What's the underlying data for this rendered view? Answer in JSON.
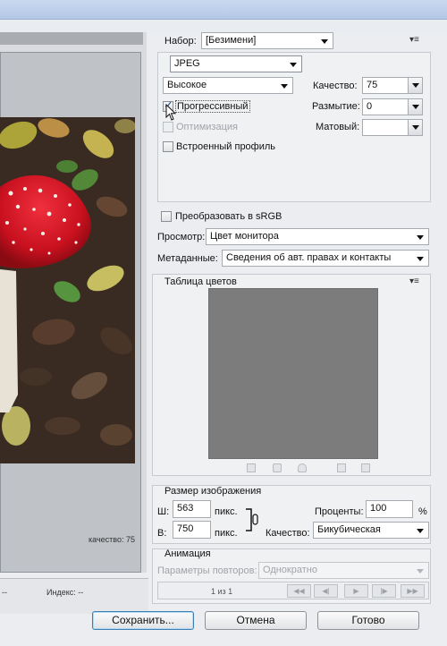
{
  "preset": {
    "label": "Набор:",
    "value": "[Безимени]"
  },
  "format": {
    "value": "JPEG"
  },
  "quality_preset": {
    "value": "Высокое"
  },
  "quality": {
    "label": "Качество:",
    "value": "75"
  },
  "blur": {
    "label": "Размытие:",
    "value": "0"
  },
  "matte": {
    "label": "Матовый:",
    "value": ""
  },
  "checks": {
    "progressive": {
      "label": "Прогрессивный",
      "checked": true
    },
    "optimized": {
      "label": "Оптимизация",
      "checked": false,
      "disabled": true
    },
    "embed_profile": {
      "label": "Встроенный профиль",
      "checked": false
    }
  },
  "convert_srgb": {
    "label": "Преобразовать в sRGB",
    "checked": false
  },
  "preview": {
    "label": "Просмотр:",
    "value": "Цвет монитора"
  },
  "metadata": {
    "label": "Метаданные:",
    "value": "Сведения об авт. правах и контакты"
  },
  "color_table": {
    "title": "Таблица цветов",
    "swatch_color": "#7c7c7c"
  },
  "image_size": {
    "title": "Размер изображения",
    "width_label": "Ш:",
    "width_value": "563",
    "width_unit": "пикс.",
    "height_label": "В:",
    "height_value": "750",
    "height_unit": "пикс.",
    "percent_label": "Проценты:",
    "percent_value": "100",
    "percent_unit": "%",
    "quality_label": "Качество:",
    "quality_value": "Бикубическая"
  },
  "animation": {
    "title": "Анимация",
    "loop_label": "Параметры повторов:",
    "loop_value": "Однократно",
    "frame_counter": "1 из 1"
  },
  "left_preview": {
    "quality_text": "качество: 75",
    "index_text": "Индекс: --",
    "dash_text": "--"
  },
  "buttons": {
    "save": "Сохранить...",
    "cancel": "Отмена",
    "done": "Готово"
  },
  "icons": [
    "panel-menu-icon",
    "chain-link-icon",
    "first-frame-icon",
    "prev-frame-icon",
    "play-icon",
    "next-frame-icon",
    "last-frame-icon"
  ]
}
